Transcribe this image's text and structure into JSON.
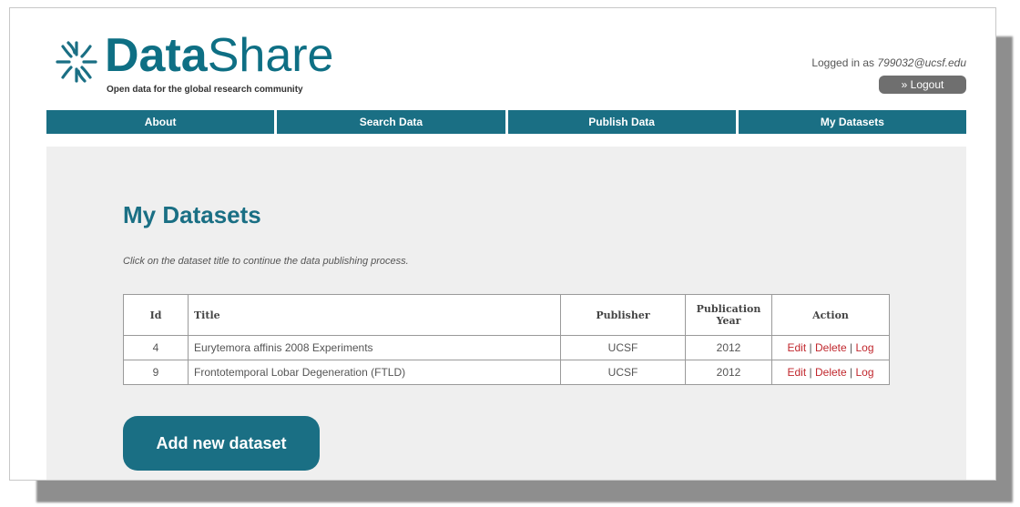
{
  "brand": {
    "name_bold": "Data",
    "name_thin": "Share",
    "tagline": "Open data for the global research community"
  },
  "user": {
    "logged_in_prefix": "Logged in as",
    "email": "799032@ucsf.edu",
    "logout_label": "» Logout"
  },
  "nav": {
    "items": [
      {
        "label": "About"
      },
      {
        "label": "Search Data"
      },
      {
        "label": "Publish Data"
      },
      {
        "label": "My Datasets"
      }
    ]
  },
  "page": {
    "title": "My Datasets",
    "instructions": "Click on the dataset title to continue the data publishing process."
  },
  "table": {
    "headers": {
      "id": "Id",
      "title": "Title",
      "publisher": "Publisher",
      "year": "Publication Year",
      "action": "Action"
    },
    "rows": [
      {
        "id": "4",
        "title": "Eurytemora affinis 2008 Experiments",
        "publisher": "UCSF",
        "year": "2012",
        "edit": "Edit",
        "delete": "Delete",
        "log": "Log"
      },
      {
        "id": "9",
        "title": "Frontotemporal Lobar Degeneration (FTLD)",
        "publisher": "UCSF",
        "year": "2012",
        "edit": "Edit",
        "delete": "Delete",
        "log": "Log"
      }
    ]
  },
  "actions": {
    "add_label": "Add new dataset"
  },
  "colors": {
    "brand_teal": "#1a6f84",
    "action_red": "#c1272d",
    "content_bg": "#efefef"
  },
  "icons": {
    "logo": "asterisk-burst-icon"
  }
}
